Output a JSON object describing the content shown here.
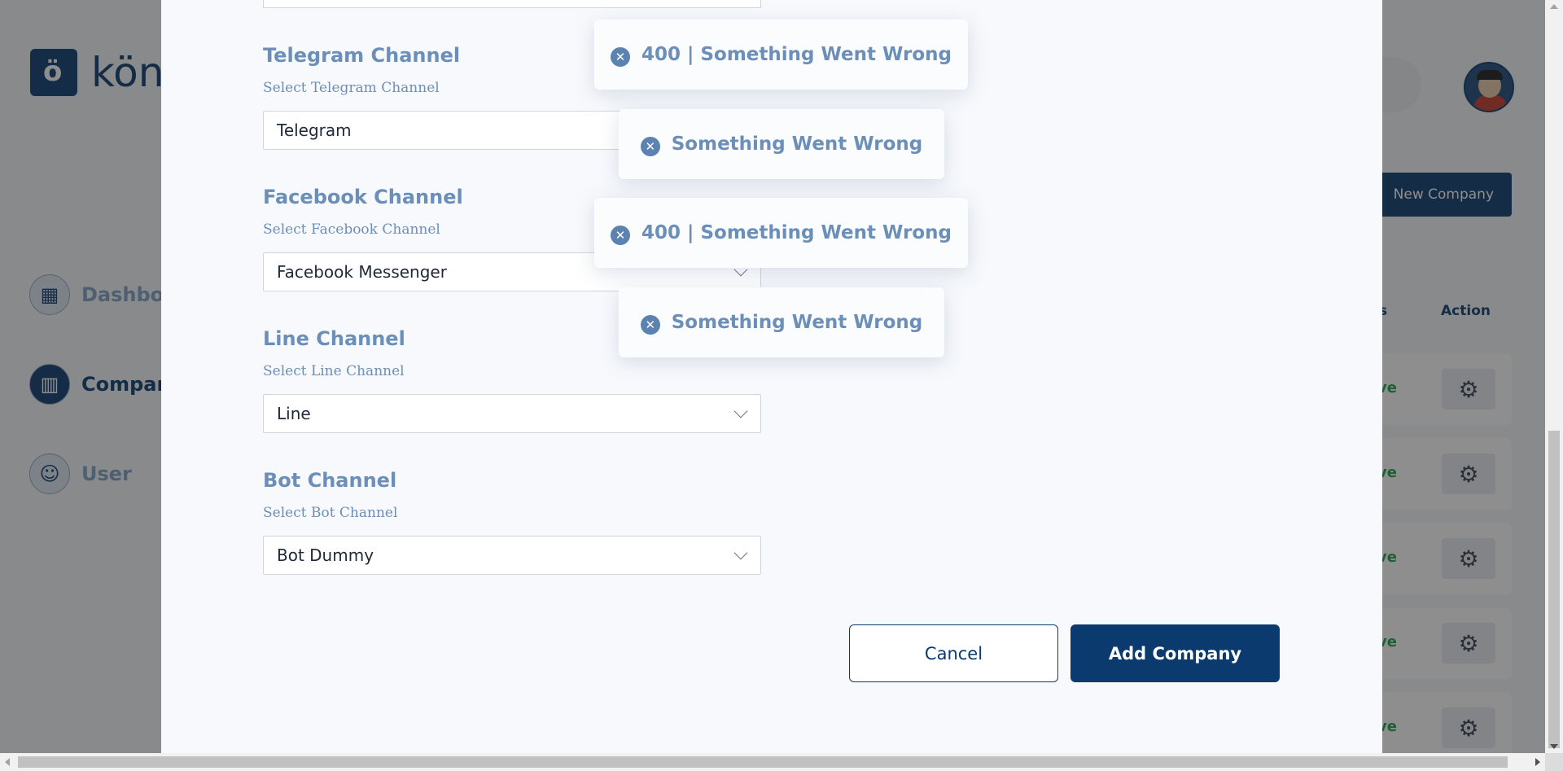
{
  "background": {
    "logo_letter": "ö",
    "logo_text": "kön",
    "nav": [
      {
        "label": "Dashboard",
        "icon": "dashboard-icon"
      },
      {
        "label": "Company",
        "icon": "company-icon"
      },
      {
        "label": "User",
        "icon": "user-icon"
      }
    ],
    "new_company_label": "New Company",
    "table": {
      "status_header_fragment": "s",
      "action_header": "Action",
      "row_status_fragment": "ve",
      "rows": 5
    }
  },
  "modal": {
    "telegram": {
      "title": "Telegram Channel",
      "subtitle": "Select Telegram Channel",
      "value": "Telegram"
    },
    "facebook": {
      "title": "Facebook Channel",
      "subtitle": "Select Facebook Channel",
      "value": "Facebook Messenger"
    },
    "line": {
      "title": "Line Channel",
      "subtitle": "Select Line Channel",
      "value": "Line"
    },
    "bot": {
      "title": "Bot Channel",
      "subtitle": "Select Bot Channel",
      "value": "Bot Dummy"
    },
    "cancel_label": "Cancel",
    "add_label": "Add Company"
  },
  "toasts": [
    {
      "message": "400 | Something Went Wrong"
    },
    {
      "message": "Something Went Wrong"
    },
    {
      "message": "400 | Something Went Wrong"
    },
    {
      "message": "Something Went Wrong"
    }
  ],
  "colors": {
    "primary": "#0b3a6e",
    "accent_text": "#6b8fb8",
    "status_active": "#16a34a"
  }
}
